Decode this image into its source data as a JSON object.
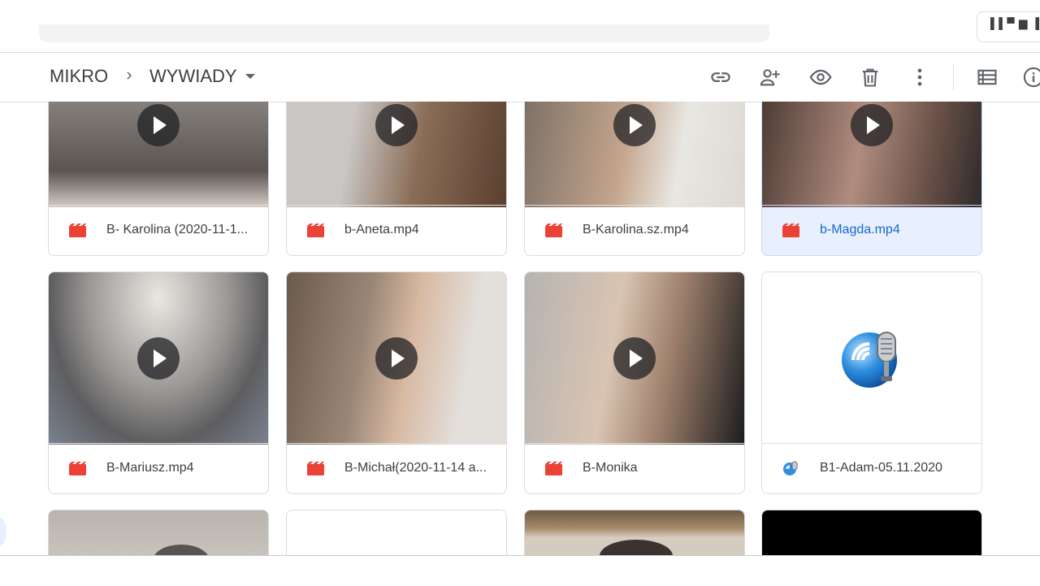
{
  "topbar": {
    "account_chip_text": "▌▌▀ ▆ ▐"
  },
  "breadcrumb": {
    "parent": "MIKRO",
    "current": "WYWIADY"
  },
  "toolbar": {
    "icons": [
      "link-icon",
      "add-person-icon",
      "preview-eye-icon",
      "trash-icon",
      "more-vert-icon",
      "list-view-icon",
      "info-icon"
    ]
  },
  "files": [
    {
      "name": "B- Karolina (2020-11-1...",
      "type": "video",
      "thumb_bg": "#8e8a86"
    },
    {
      "name": "b-Aneta.mp4",
      "type": "video",
      "thumb_bg": "#9b8f87"
    },
    {
      "name": "B-Karolina.sz.mp4",
      "type": "video",
      "thumb_bg": "#b7b0a6"
    },
    {
      "name": "b-Magda.mp4",
      "type": "video",
      "selected": true,
      "thumb_bg": "#8c7168"
    },
    {
      "name": "B-Mariusz.mp4",
      "type": "video",
      "thumb_bg": "#7d7a79"
    },
    {
      "name": "B-Michał(2020-11-14 a...",
      "type": "video",
      "thumb_bg": "#8d7a6a"
    },
    {
      "name": "B-Monika",
      "type": "video",
      "thumb_bg": "#9a9089"
    },
    {
      "name": "B1-Adam-05.11.2020",
      "type": "audio",
      "thumb_bg": "#ffffff"
    },
    {
      "name": "",
      "type": "video",
      "thumb_bg": "#b9b4ae"
    },
    {
      "name": "",
      "type": "blank",
      "thumb_bg": "#ffffff"
    },
    {
      "name": "",
      "type": "video",
      "thumb_bg": "#9e8c78"
    },
    {
      "name": "",
      "type": "video",
      "thumb_bg": "#000000"
    }
  ],
  "colors": {
    "video_icon": "#ea4335",
    "selected_bg": "#e8f0fe",
    "selected_text": "#1967d2"
  }
}
